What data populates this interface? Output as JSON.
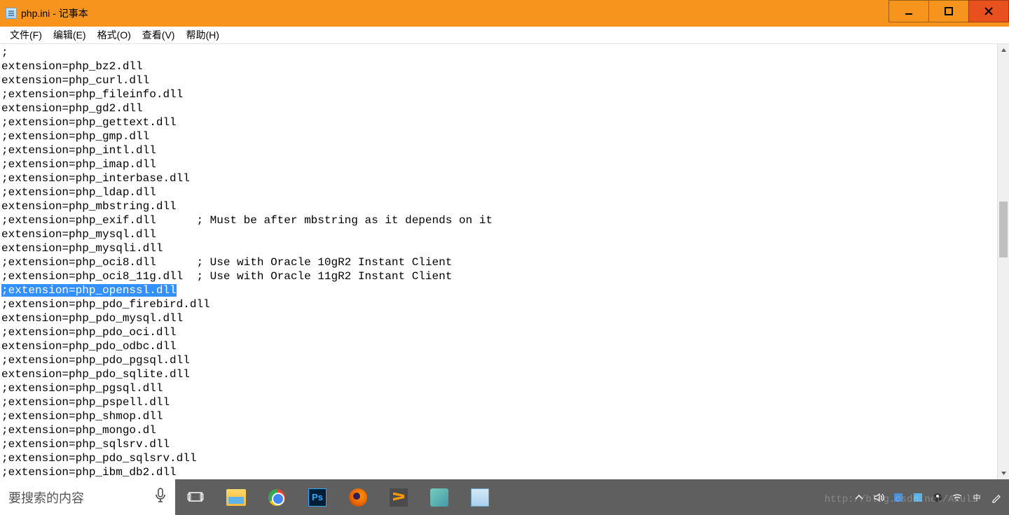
{
  "window": {
    "title": "php.ini - 记事本"
  },
  "menu": {
    "file": "文件(F)",
    "edit": "编辑(E)",
    "format": "格式(O)",
    "view": "查看(V)",
    "help": "帮助(H)"
  },
  "editor": {
    "lines": [
      ";",
      "extension=php_bz2.dll",
      "extension=php_curl.dll",
      ";extension=php_fileinfo.dll",
      "extension=php_gd2.dll",
      ";extension=php_gettext.dll",
      ";extension=php_gmp.dll",
      ";extension=php_intl.dll",
      ";extension=php_imap.dll",
      ";extension=php_interbase.dll",
      ";extension=php_ldap.dll",
      "extension=php_mbstring.dll",
      ";extension=php_exif.dll      ; Must be after mbstring as it depends on it",
      "extension=php_mysql.dll",
      "extension=php_mysqli.dll",
      ";extension=php_oci8.dll      ; Use with Oracle 10gR2 Instant Client",
      ";extension=php_oci8_11g.dll  ; Use with Oracle 11gR2 Instant Client",
      ";extension=php_openssl.dll",
      ";extension=php_pdo_firebird.dll",
      "extension=php_pdo_mysql.dll",
      ";extension=php_pdo_oci.dll",
      "extension=php_pdo_odbc.dll",
      ";extension=php_pdo_pgsql.dll",
      "extension=php_pdo_sqlite.dll",
      ";extension=php_pgsql.dll",
      ";extension=php_pspell.dll",
      ";extension=php_shmop.dll",
      ";extension=php_mongo.dl",
      ";extension=php_sqlsrv.dll",
      ";extension=php_pdo_sqlsrv.dll",
      ";extension=php_ibm_db2.dll"
    ],
    "highlighted_index": 17
  },
  "taskbar": {
    "search_placeholder": "要搜索的内容"
  },
  "watermark": "http://blog.csdn.net/Akuli"
}
